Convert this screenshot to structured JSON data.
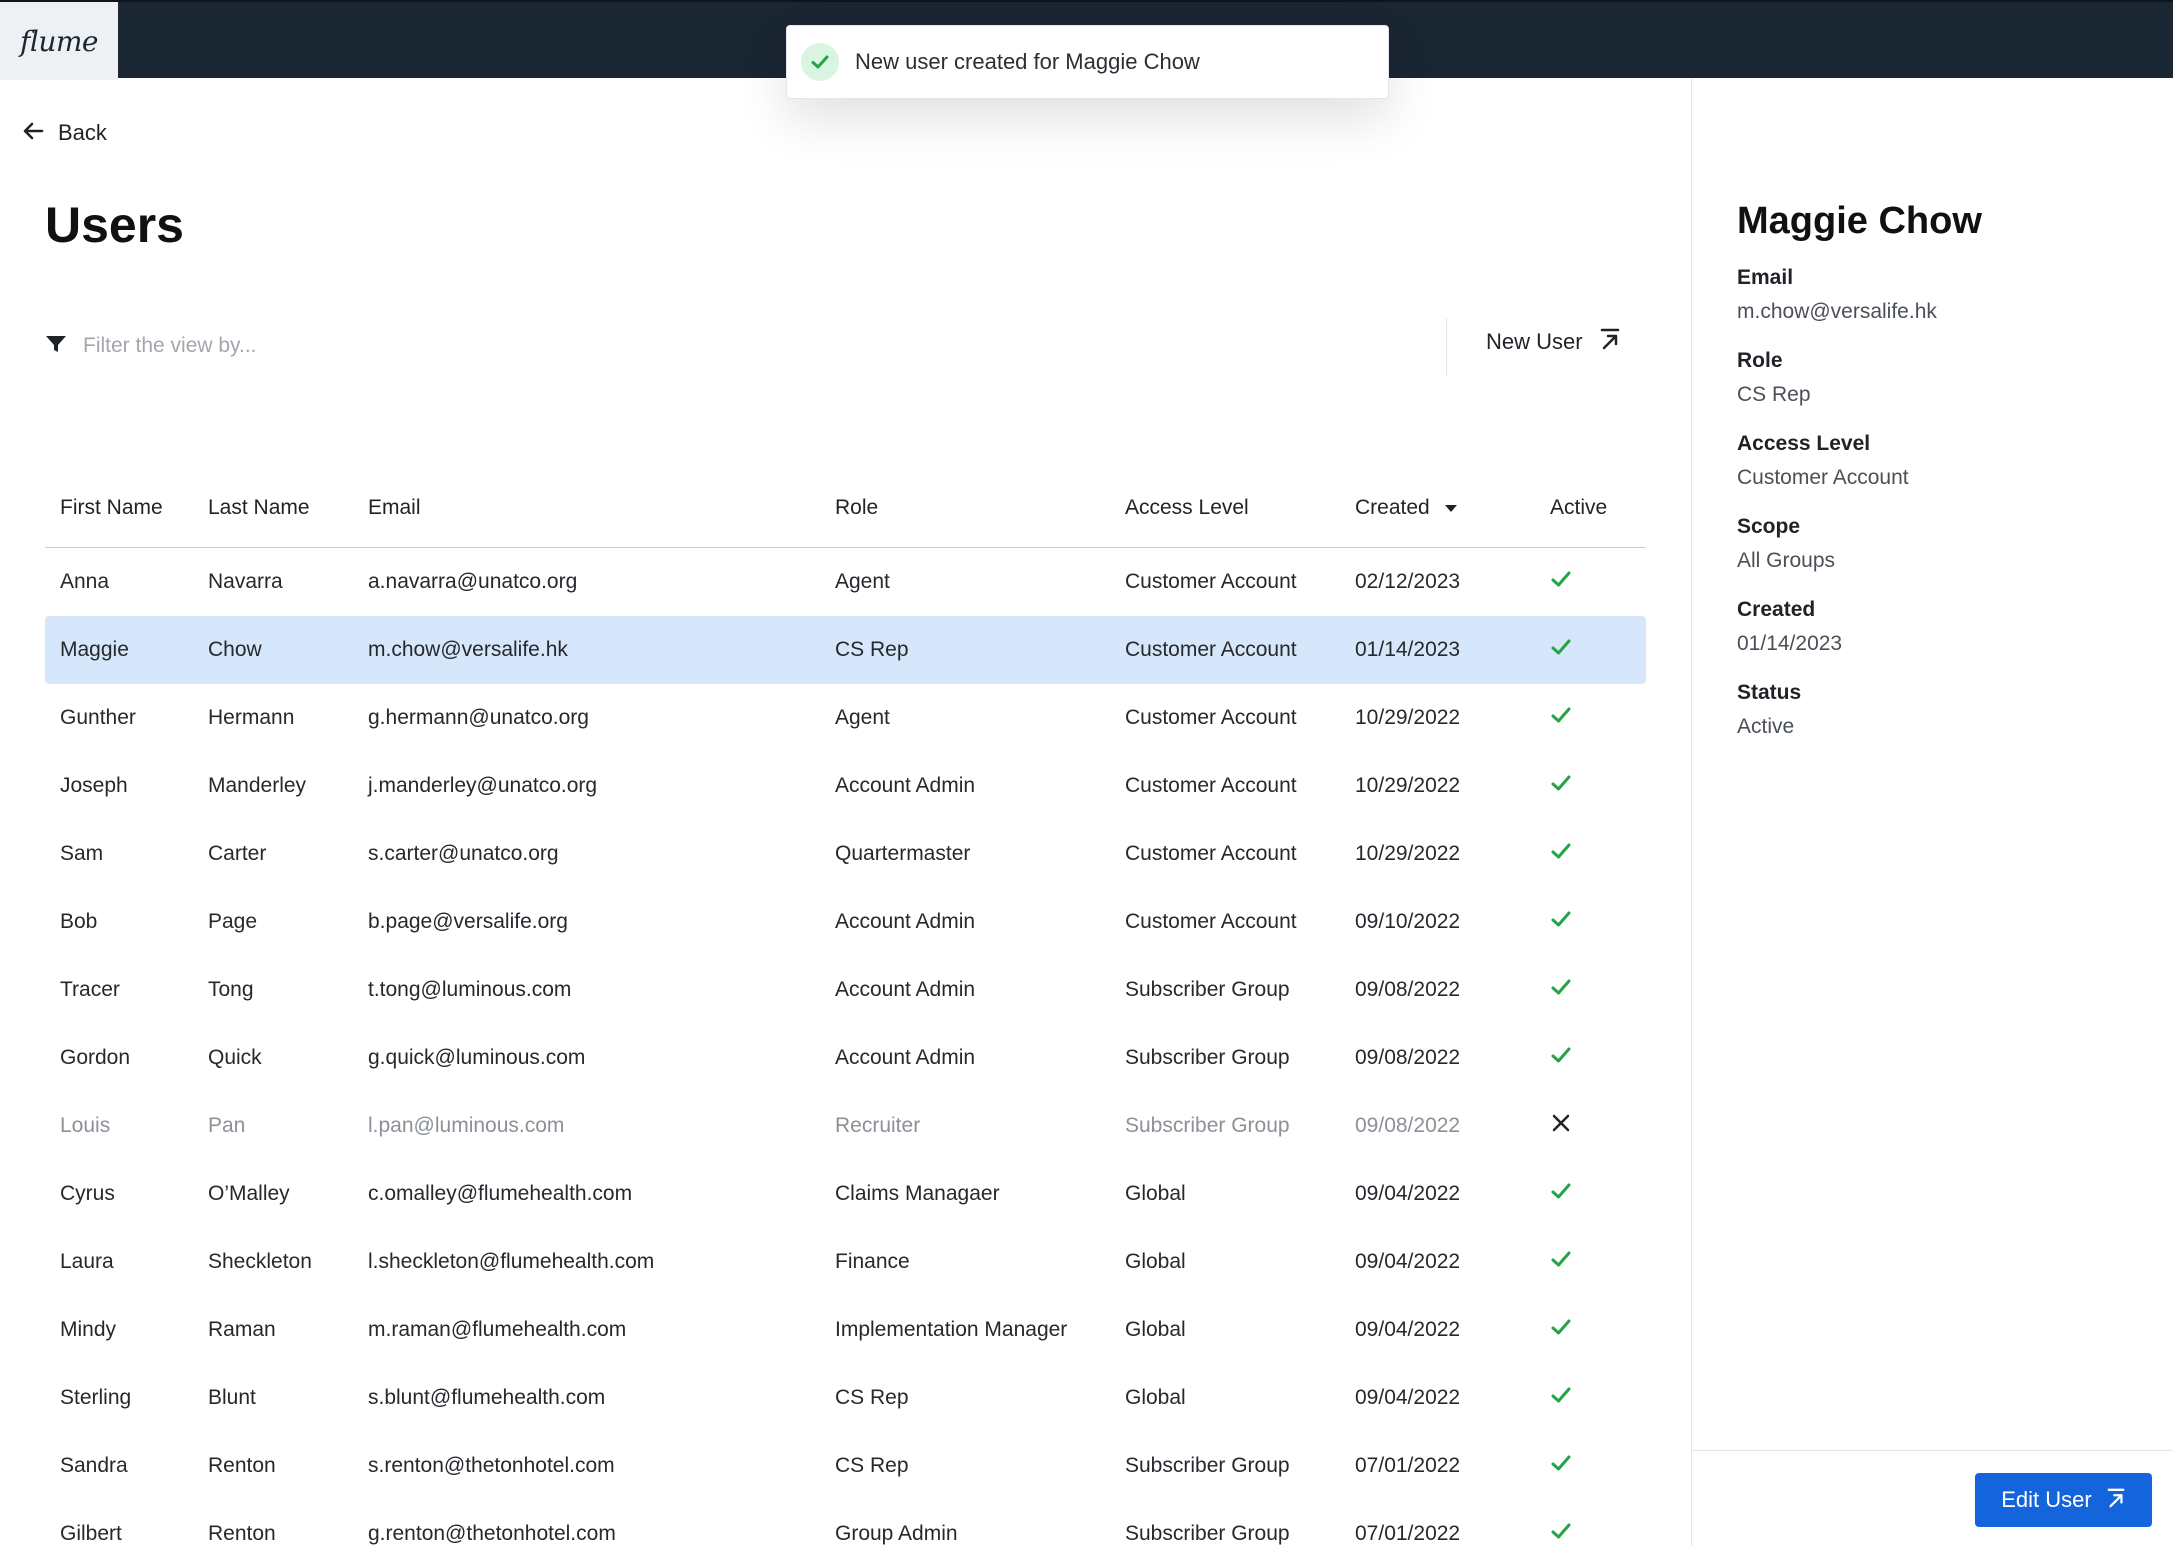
{
  "app": {
    "logo": "flume"
  },
  "toast": {
    "message": "New user created for Maggie Chow"
  },
  "nav": {
    "back_label": "Back"
  },
  "page": {
    "title": "Users"
  },
  "filter": {
    "placeholder": "Filter the view by...",
    "value": ""
  },
  "actions": {
    "new_user_label": "New User"
  },
  "table": {
    "headers": {
      "first_name": "First Name",
      "last_name": "Last Name",
      "email": "Email",
      "role": "Role",
      "access_level": "Access Level",
      "created": "Created",
      "active": "Active"
    },
    "sort": {
      "column": "created",
      "direction": "descending"
    },
    "rows": [
      {
        "first": "Anna",
        "last": "Navarra",
        "email": "a.navarra@unatco.org",
        "role": "Agent",
        "access": "Customer Account",
        "created": "02/12/2023",
        "active": true,
        "selected": false
      },
      {
        "first": "Maggie",
        "last": "Chow",
        "email": "m.chow@versalife.hk",
        "role": "CS Rep",
        "access": "Customer Account",
        "created": "01/14/2023",
        "active": true,
        "selected": true
      },
      {
        "first": "Gunther",
        "last": "Hermann",
        "email": "g.hermann@unatco.org",
        "role": "Agent",
        "access": "Customer Account",
        "created": "10/29/2022",
        "active": true,
        "selected": false
      },
      {
        "first": "Joseph",
        "last": "Manderley",
        "email": "j.manderley@unatco.org",
        "role": "Account Admin",
        "access": "Customer Account",
        "created": "10/29/2022",
        "active": true,
        "selected": false
      },
      {
        "first": "Sam",
        "last": "Carter",
        "email": "s.carter@unatco.org",
        "role": "Quartermaster",
        "access": "Customer Account",
        "created": "10/29/2022",
        "active": true,
        "selected": false
      },
      {
        "first": "Bob",
        "last": "Page",
        "email": "b.page@versalife.org",
        "role": "Account Admin",
        "access": "Customer Account",
        "created": "09/10/2022",
        "active": true,
        "selected": false
      },
      {
        "first": "Tracer",
        "last": "Tong",
        "email": "t.tong@luminous.com",
        "role": "Account Admin",
        "access": "Subscriber Group",
        "created": "09/08/2022",
        "active": true,
        "selected": false
      },
      {
        "first": "Gordon",
        "last": "Quick",
        "email": "g.quick@luminous.com",
        "role": "Account Admin",
        "access": "Subscriber Group",
        "created": "09/08/2022",
        "active": true,
        "selected": false
      },
      {
        "first": "Louis",
        "last": "Pan",
        "email": "l.pan@luminous.com",
        "role": "Recruiter",
        "access": "Subscriber Group",
        "created": "09/08/2022",
        "active": false,
        "selected": false
      },
      {
        "first": "Cyrus",
        "last": "O’Malley",
        "email": "c.omalley@flumehealth.com",
        "role": "Claims Managaer",
        "access": "Global",
        "created": "09/04/2022",
        "active": true,
        "selected": false
      },
      {
        "first": "Laura",
        "last": "Sheckleton",
        "email": "l.sheckleton@flumehealth.com",
        "role": "Finance",
        "access": "Global",
        "created": "09/04/2022",
        "active": true,
        "selected": false
      },
      {
        "first": "Mindy",
        "last": "Raman",
        "email": "m.raman@flumehealth.com",
        "role": "Implementation Manager",
        "access": "Global",
        "created": "09/04/2022",
        "active": true,
        "selected": false
      },
      {
        "first": "Sterling",
        "last": "Blunt",
        "email": "s.blunt@flumehealth.com",
        "role": "CS Rep",
        "access": "Global",
        "created": "09/04/2022",
        "active": true,
        "selected": false
      },
      {
        "first": "Sandra",
        "last": "Renton",
        "email": "s.renton@thetonhotel.com",
        "role": "CS Rep",
        "access": "Subscriber Group",
        "created": "07/01/2022",
        "active": true,
        "selected": false
      },
      {
        "first": "Gilbert",
        "last": "Renton",
        "email": "g.renton@thetonhotel.com",
        "role": "Group Admin",
        "access": "Subscriber Group",
        "created": "07/01/2022",
        "active": true,
        "selected": false
      }
    ]
  },
  "detail": {
    "name": "Maggie Chow",
    "fields": [
      {
        "label": "Email",
        "value": "m.chow@versalife.hk"
      },
      {
        "label": "Role",
        "value": "CS Rep"
      },
      {
        "label": "Access Level",
        "value": "Customer Account"
      },
      {
        "label": "Scope",
        "value": "All Groups"
      },
      {
        "label": "Created",
        "value": "01/14/2023"
      },
      {
        "label": "Status",
        "value": "Active"
      }
    ],
    "edit_label": "Edit User"
  },
  "colors": {
    "topbar": "#1b2633",
    "selected_row": "#d6e6fb",
    "check_green": "#22a546",
    "primary_button": "#1464dc"
  },
  "icons": {
    "toast": "check-circle-icon",
    "back": "arrow-left-icon",
    "filter": "filter-funnel-icon",
    "new_user": "arrow-up-right-bar-icon",
    "sort": "caret-down-icon",
    "active_yes": "check-icon",
    "active_no": "x-icon",
    "edit_user": "arrow-up-right-bar-icon"
  }
}
